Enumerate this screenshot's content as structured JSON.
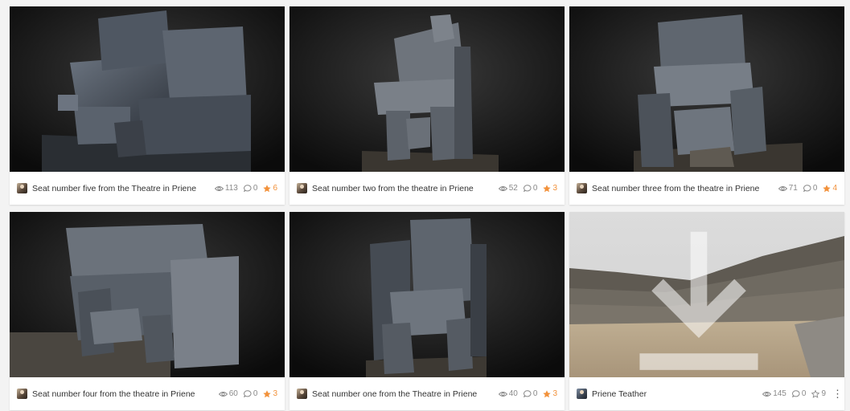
{
  "cards": [
    {
      "title": "Seat number five from the Theatre in Priene",
      "views": "113",
      "comments": "0",
      "likes": "6",
      "liked": true
    },
    {
      "title": "Seat number two from the theatre in Priene",
      "views": "52",
      "comments": "0",
      "likes": "3",
      "liked": true
    },
    {
      "title": "Seat number three from the theatre in Priene",
      "views": "71",
      "comments": "0",
      "likes": "4",
      "liked": true
    },
    {
      "title": "Seat number four from the theatre in Priene",
      "views": "60",
      "comments": "0",
      "likes": "3",
      "liked": true
    },
    {
      "title": "Seat number one from the Theatre in Priene",
      "views": "40",
      "comments": "0",
      "likes": "3",
      "liked": true
    },
    {
      "title": "Priene Teather",
      "views": "145",
      "comments": "0",
      "likes": "9",
      "liked": false,
      "more": "⋮"
    }
  ],
  "icons": {
    "views": "eye-icon",
    "comments": "comment-icon",
    "likes": "star-icon",
    "download": "download-icon"
  },
  "colors": {
    "like_active": "#f2913a",
    "muted": "#8a8a8a",
    "background": "#f3f3f3"
  }
}
